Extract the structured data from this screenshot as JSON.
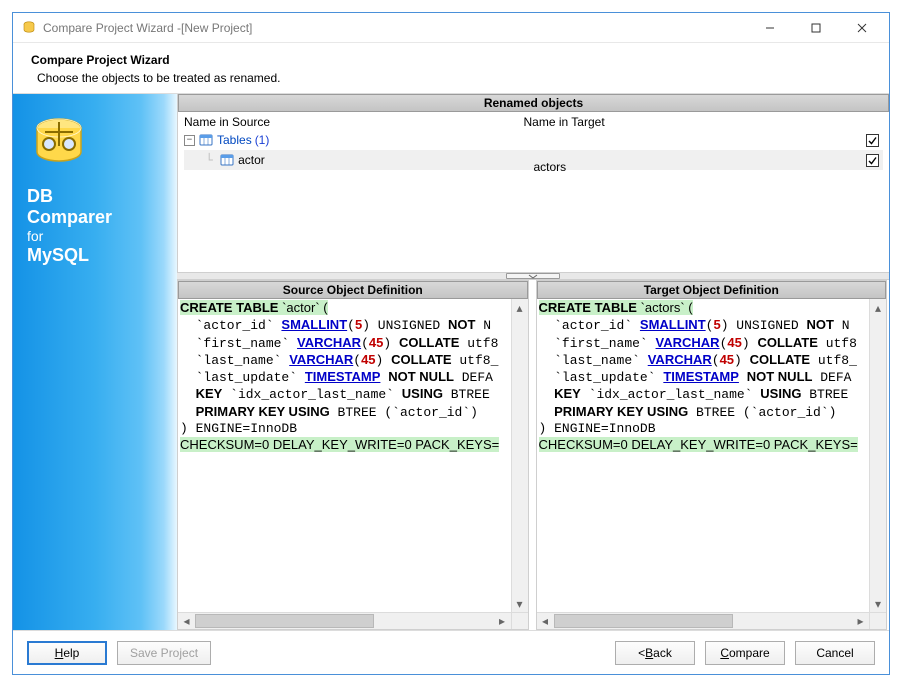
{
  "window": {
    "title": "Compare Project Wizard -[New Project]"
  },
  "header": {
    "title": "Compare Project Wizard",
    "subtitle": "Choose the objects to be treated as renamed."
  },
  "brand": {
    "l1": "DB",
    "l2": "Comparer",
    "l3": "for",
    "l4": "MySQL"
  },
  "renamed": {
    "panel_title": "Renamed objects",
    "col_source": "Name in Source",
    "col_target": "Name in Target",
    "tree": {
      "group_label": "Tables",
      "group_count": "(1)",
      "items": [
        {
          "source": "actor",
          "target": "actors",
          "checked": true
        }
      ],
      "group_checked": true
    }
  },
  "defs": {
    "source_title": "Source Object Definition",
    "target_title": "Target Object Definition",
    "source_sql": {
      "create_name": "actor",
      "lines_plain": [
        "  `actor_id` SMALLINT(5) UNSIGNED NOT N",
        "  `first_name` VARCHAR(45) COLLATE utf8",
        "  `last_name` VARCHAR(45) COLLATE utf8_",
        "  `last_update` TIMESTAMP NOT NULL DEFA",
        "  KEY `idx_actor_last_name` USING BTREE",
        "  PRIMARY KEY USING BTREE (`actor_id`)",
        ") ENGINE=InnoDB"
      ],
      "checksum": "CHECKSUM=0 DELAY_KEY_WRITE=0 PACK_KEYS="
    },
    "target_sql": {
      "create_name": "actors",
      "lines_plain": [
        "  `actor_id` SMALLINT(5) UNSIGNED NOT N",
        "  `first_name` VARCHAR(45) COLLATE utf8",
        "  `last_name` VARCHAR(45) COLLATE utf8_",
        "  `last_update` TIMESTAMP NOT NULL DEFA",
        "  KEY `idx_actor_last_name` USING BTREE",
        "  PRIMARY KEY USING BTREE (`actor_id`)",
        ") ENGINE=InnoDB"
      ],
      "checksum": "CHECKSUM=0 DELAY_KEY_WRITE=0 PACK_KEYS="
    }
  },
  "footer": {
    "help": "Help",
    "save": "Save Project",
    "back": "< Back",
    "compare": "Compare",
    "cancel": "Cancel"
  }
}
